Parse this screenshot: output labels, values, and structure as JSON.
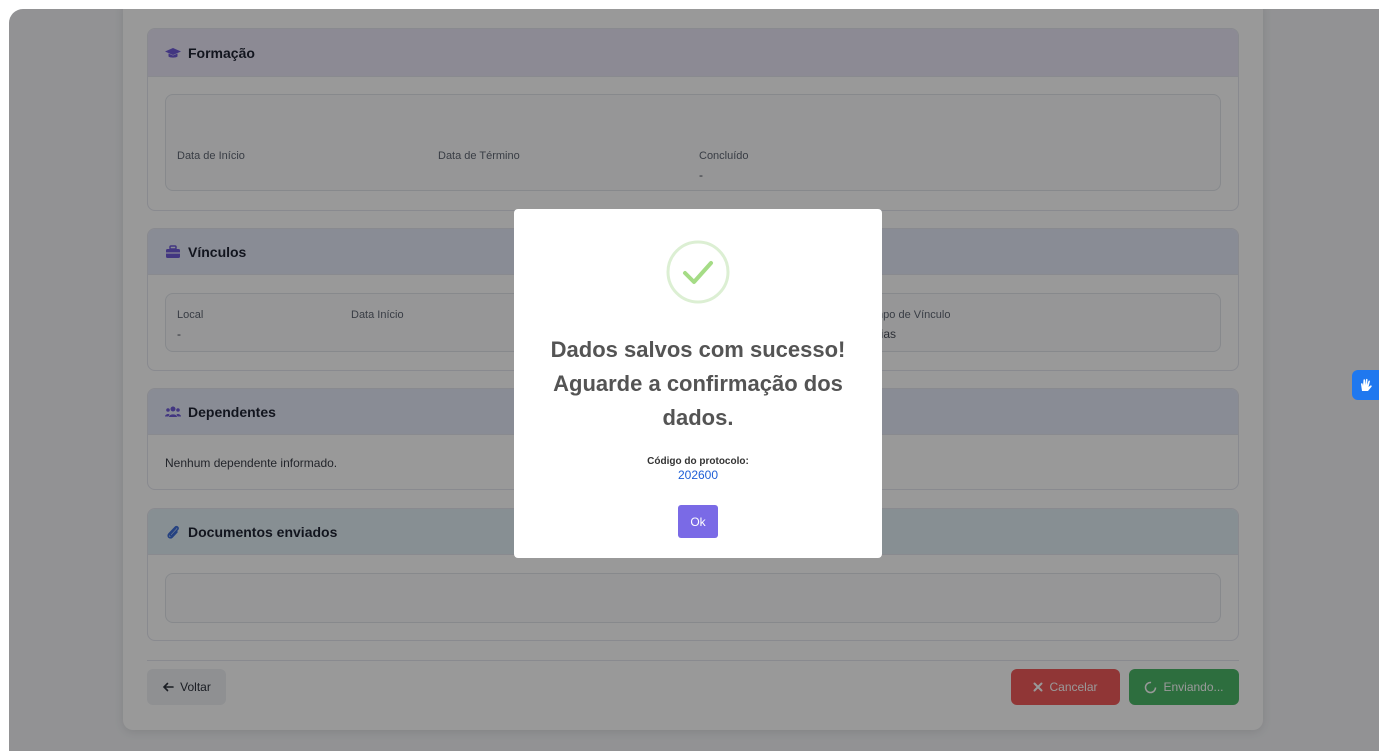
{
  "sections": {
    "formacao": {
      "title": "Formação",
      "fields": [
        {
          "label": "Data de Início",
          "value": ""
        },
        {
          "label": "Data de Término",
          "value": ""
        },
        {
          "label": "Concluído",
          "value": "-"
        }
      ]
    },
    "vinculos": {
      "title": "Vínculos",
      "fields": [
        {
          "label": "Local",
          "value": "-"
        },
        {
          "label": "Data Início",
          "value": ""
        },
        {
          "label": "mpo de Vínculo",
          "value": "dias"
        }
      ]
    },
    "dependentes": {
      "title": "Dependentes",
      "empty_text": "Nenhum dependente informado."
    },
    "documentos": {
      "title": "Documentos enviados"
    }
  },
  "footer": {
    "back_label": "Voltar",
    "cancel_label": "Cancelar",
    "send_label": "Enviando..."
  },
  "modal": {
    "title": "Dados salvos com sucesso! Aguarde a confirmação dos dados.",
    "protocol_label": "Código do protocolo:",
    "protocol_code": "202600",
    "ok_label": "Ok"
  },
  "colors": {
    "accent_purple": "#7a6ae6",
    "cancel_red": "#f15a5a",
    "send_green": "#4bb868",
    "success_green": "#a5dc86",
    "widget_blue": "#1f78ef"
  },
  "icons": {
    "formacao": "graduation-cap-icon",
    "vinculos": "briefcase-icon",
    "dependentes": "users-icon",
    "documentos": "paperclip-icon",
    "back": "arrow-left-icon",
    "cancel": "close-icon",
    "send": "spinner-icon",
    "widget": "sign-language-hand-icon",
    "success": "check-circle-icon"
  }
}
